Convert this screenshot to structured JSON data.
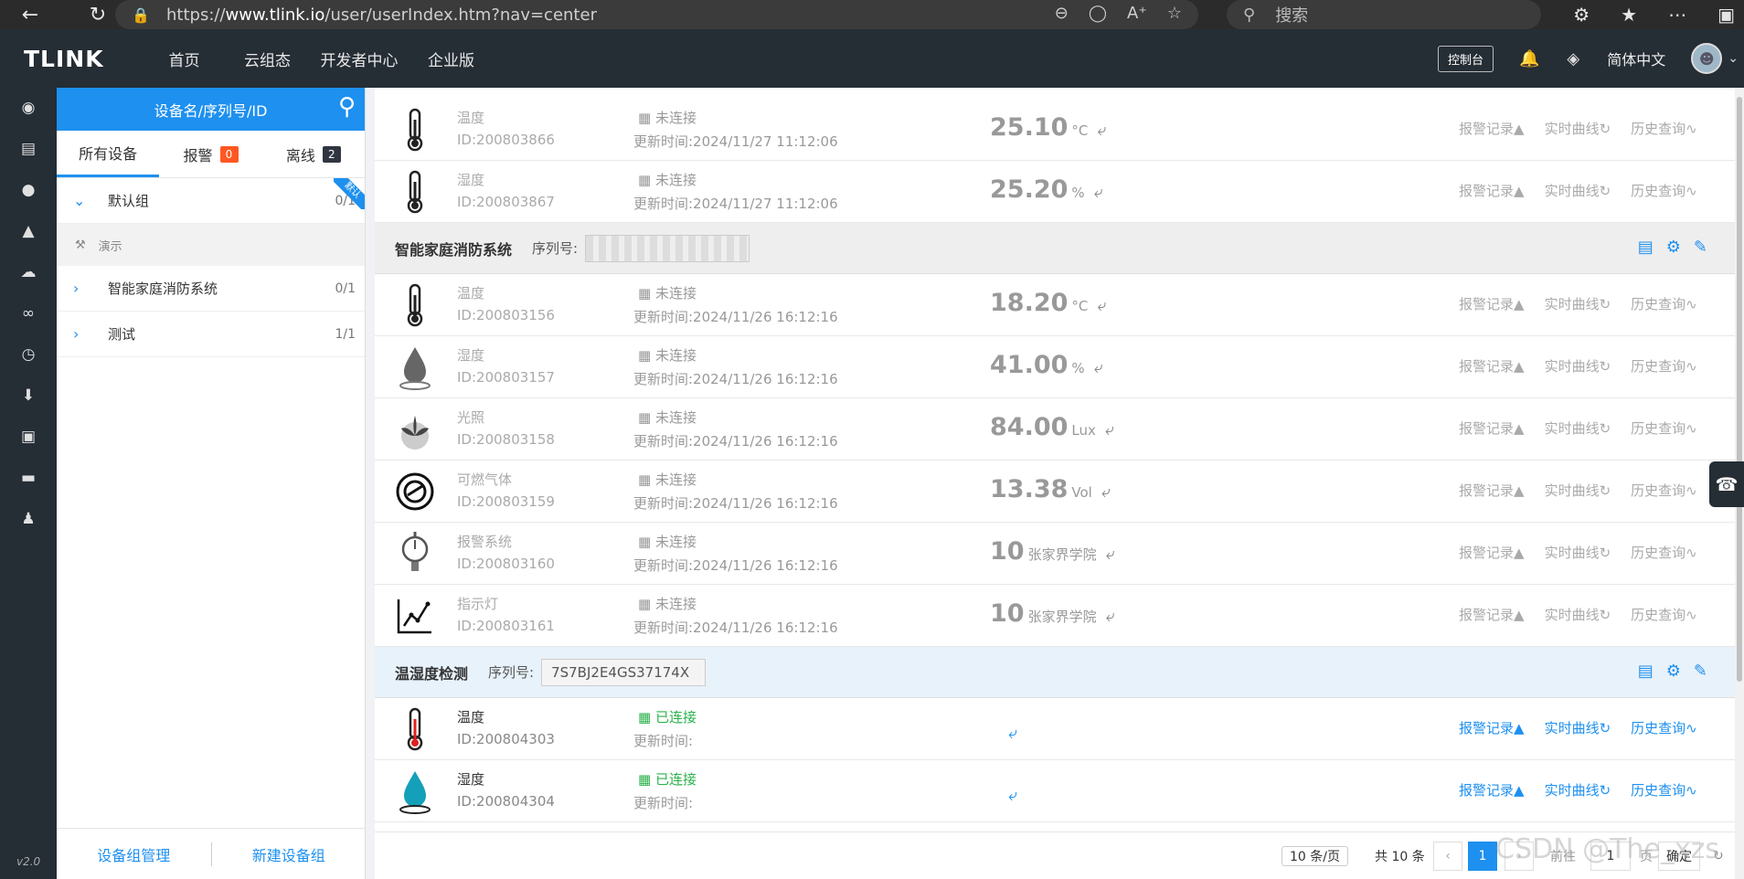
{
  "browser": {
    "url_prefix": "https://",
    "url_host": "www.tlink.io",
    "url_path": "/user/userIndex.htm?nav=center",
    "search_placeholder": "搜索"
  },
  "topnav": {
    "logo": "TLINK",
    "items": [
      "首页",
      "云组态",
      "开发者中心",
      "企业版"
    ],
    "console": "控制台",
    "lang": "简体中文"
  },
  "sidebar": {
    "version": "v2.0"
  },
  "tree": {
    "search_label": "设备名/序列号/ID",
    "tabs": [
      {
        "label": "所有设备",
        "badge": ""
      },
      {
        "label": "报警",
        "badge": "0"
      },
      {
        "label": "离线",
        "badge": "2"
      }
    ],
    "ribbon": "默认",
    "groups": [
      {
        "name": "默认组",
        "count": "0/1"
      },
      {
        "name": "智能家庭消防系统",
        "count": "0/1"
      },
      {
        "name": "测试",
        "count": "1/1"
      }
    ],
    "sub_item": "演示",
    "footer_manage": "设备组管理",
    "footer_new": "新建设备组"
  },
  "devices_top": [
    {
      "name": "温度",
      "id": "ID:200803866",
      "status": "未连接",
      "time": "更新时间:2024/11/27 11:12:06",
      "value": "25.10",
      "unit": "°C",
      "icon": "thermometer-icon"
    },
    {
      "name": "湿度",
      "id": "ID:200803867",
      "status": "未连接",
      "time": "更新时间:2024/11/27 11:12:06",
      "value": "25.20",
      "unit": "%",
      "icon": "thermometer-icon"
    }
  ],
  "group_fire": {
    "name": "智能家庭消防系统",
    "serial_label": "序列号:",
    "serial": "",
    "devices": [
      {
        "name": "温度",
        "id": "ID:200803156",
        "status": "未连接",
        "time": "更新时间:2024/11/26 16:12:16",
        "value": "18.20",
        "unit": "°C",
        "icon": "thermometer-icon"
      },
      {
        "name": "湿度",
        "id": "ID:200803157",
        "status": "未连接",
        "time": "更新时间:2024/11/26 16:12:16",
        "value": "41.00",
        "unit": "%",
        "icon": "water-drop-icon"
      },
      {
        "name": "光照",
        "id": "ID:200803158",
        "status": "未连接",
        "time": "更新时间:2024/11/26 16:12:16",
        "value": "84.00",
        "unit": "Lux",
        "icon": "plant-icon"
      },
      {
        "name": "可燃气体",
        "id": "ID:200803159",
        "status": "未连接",
        "time": "更新时间:2024/11/26 16:12:16",
        "value": "13.38",
        "unit": "Vol",
        "icon": "gas-mask-icon"
      },
      {
        "name": "报警系统",
        "id": "ID:200803160",
        "status": "未连接",
        "time": "更新时间:2024/11/26 16:12:16",
        "value": "10",
        "unit": "张家界学院",
        "icon": "gauge-icon"
      },
      {
        "name": "指示灯",
        "id": "ID:200803161",
        "status": "未连接",
        "time": "更新时间:2024/11/26 16:12:16",
        "value": "10",
        "unit": "张家界学院",
        "icon": "line-chart-icon"
      }
    ]
  },
  "group_th": {
    "name": "温湿度检测",
    "serial_label": "序列号:",
    "serial": "7S7BJ2E4GS37174X",
    "devices": [
      {
        "name": "温度",
        "id": "ID:200804303",
        "status": "已连接",
        "time": "更新时间:",
        "value": "",
        "unit": "",
        "icon": "thermometer-icon"
      },
      {
        "name": "湿度",
        "id": "ID:200804304",
        "status": "已连接",
        "time": "更新时间:",
        "value": "",
        "unit": "",
        "icon": "water-drop-icon"
      }
    ]
  },
  "actions": {
    "alarm": "报警记录",
    "realtime": "实时曲线",
    "history": "历史查询"
  },
  "pager": {
    "page_size": "10 条/页",
    "total": "共 10 条",
    "current": "1",
    "goto": "前往",
    "goto_value": "1",
    "page_word": "页",
    "confirm": "确定"
  },
  "watermark": "CSDN @The_xzs",
  "colors": {
    "accent": "#1e90ef",
    "nav_bg": "#252d35",
    "online": "#2bb24c",
    "alarm_badge": "#ff5722"
  }
}
